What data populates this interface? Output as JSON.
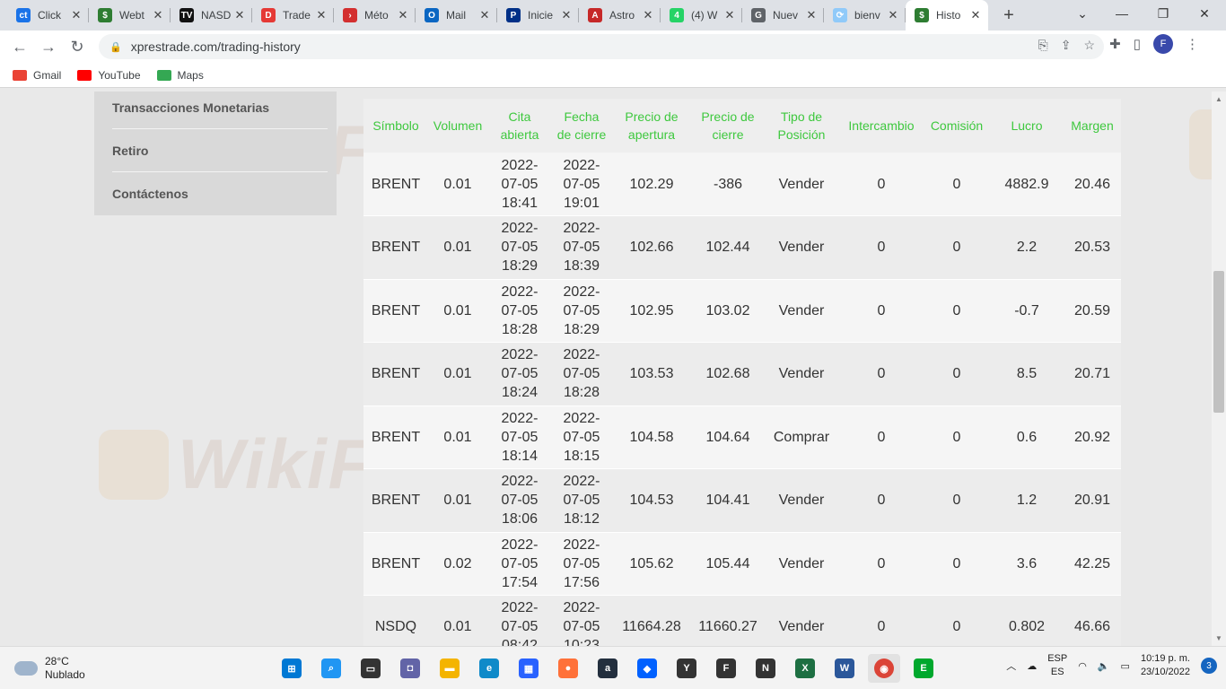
{
  "browser": {
    "tabs": [
      {
        "title": "Click",
        "color": "#1a73e8",
        "glyph": "ct"
      },
      {
        "title": "Webt",
        "color": "#2e7d32",
        "glyph": "$"
      },
      {
        "title": "NASD",
        "color": "#111111",
        "glyph": "TV"
      },
      {
        "title": "Trade",
        "color": "#e53935",
        "glyph": "D"
      },
      {
        "title": "Méto",
        "color": "#d32f2f",
        "glyph": "›"
      },
      {
        "title": "Mail",
        "color": "#0a66c2",
        "glyph": "O"
      },
      {
        "title": "Inicie",
        "color": "#003087",
        "glyph": "P"
      },
      {
        "title": "Astro",
        "color": "#c62828",
        "glyph": "A"
      },
      {
        "title": "(4) W",
        "color": "#25d366",
        "glyph": "4"
      },
      {
        "title": "Nuev",
        "color": "#5f6368",
        "glyph": "G"
      },
      {
        "title": "bienv",
        "color": "#90caf9",
        "glyph": "⟳"
      },
      {
        "title": "Histo",
        "color": "#2e7d32",
        "glyph": "$",
        "active": true
      }
    ],
    "url": "xprestrade.com/trading-history",
    "bookmarks": [
      {
        "label": "Gmail",
        "color": "#ea4335"
      },
      {
        "label": "YouTube",
        "color": "#ff0000"
      },
      {
        "label": "Maps",
        "color": "#34a853"
      }
    ],
    "profile_initial": "F"
  },
  "sidebar": {
    "items": [
      {
        "label": "Transacciones Monetarias"
      },
      {
        "label": "Retiro"
      },
      {
        "label": "Contáctenos"
      }
    ]
  },
  "history_table": {
    "headers": [
      "Símbolo",
      "Volumen",
      "Cita abierta",
      "Fecha de cierre",
      "Precio de apertura",
      "Precio de cierre",
      "Tipo de Posición",
      "Intercambio",
      "Comisión",
      "Lucro",
      "Margen"
    ],
    "rows": [
      [
        "BRENT",
        "0.01",
        "2022-07-05 18:41",
        "2022-07-05 19:01",
        "102.29",
        "-386",
        "Vender",
        "0",
        "0",
        "4882.9",
        "20.46"
      ],
      [
        "BRENT",
        "0.01",
        "2022-07-05 18:29",
        "2022-07-05 18:39",
        "102.66",
        "102.44",
        "Vender",
        "0",
        "0",
        "2.2",
        "20.53"
      ],
      [
        "BRENT",
        "0.01",
        "2022-07-05 18:28",
        "2022-07-05 18:29",
        "102.95",
        "103.02",
        "Vender",
        "0",
        "0",
        "-0.7",
        "20.59"
      ],
      [
        "BRENT",
        "0.01",
        "2022-07-05 18:24",
        "2022-07-05 18:28",
        "103.53",
        "102.68",
        "Vender",
        "0",
        "0",
        "8.5",
        "20.71"
      ],
      [
        "BRENT",
        "0.01",
        "2022-07-05 18:14",
        "2022-07-05 18:15",
        "104.58",
        "104.64",
        "Comprar",
        "0",
        "0",
        "0.6",
        "20.92"
      ],
      [
        "BRENT",
        "0.01",
        "2022-07-05 18:06",
        "2022-07-05 18:12",
        "104.53",
        "104.41",
        "Vender",
        "0",
        "0",
        "1.2",
        "20.91"
      ],
      [
        "BRENT",
        "0.02",
        "2022-07-05 17:54",
        "2022-07-05 17:56",
        "105.62",
        "105.44",
        "Vender",
        "0",
        "0",
        "3.6",
        "42.25"
      ],
      [
        "NSDQ",
        "0.01",
        "2022-07-05 08:42",
        "2022-07-05 10:23",
        "11664.28",
        "11660.27",
        "Vender",
        "0",
        "0",
        "0.802",
        "46.66"
      ]
    ]
  },
  "watermark": "WikiFX",
  "taskbar": {
    "weather_temp": "28°C",
    "weather_desc": "Nublado",
    "lang_top": "ESP",
    "lang_bottom": "ES",
    "time": "10:19 p. m.",
    "date": "23/10/2022",
    "notifications": "3"
  }
}
